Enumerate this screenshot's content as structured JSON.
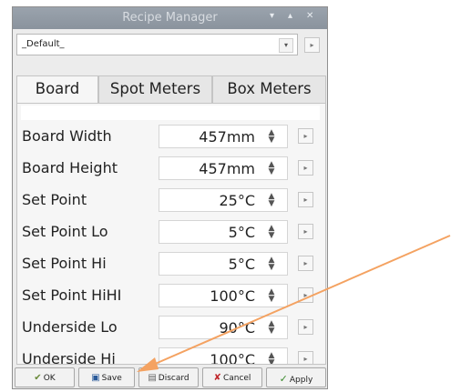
{
  "window": {
    "title": "Recipe Manager",
    "controls": [
      "▾",
      "▴",
      "✕"
    ]
  },
  "recipe_select": {
    "value": "_Default_",
    "arrow_glyph": "▾",
    "side_glyph": "▸"
  },
  "tabs": [
    {
      "label": "Board",
      "active": true
    },
    {
      "label": "Spot Meters",
      "active": false
    },
    {
      "label": "Box Meters",
      "active": false
    }
  ],
  "rows": [
    {
      "label": "Board Width",
      "value": "457mm"
    },
    {
      "label": "Board Height",
      "value": "457mm"
    },
    {
      "label": "Set Point",
      "value": "25°C"
    },
    {
      "label": "Set Point Lo",
      "value": "5°C"
    },
    {
      "label": "Set Point Hi",
      "value": "5°C"
    },
    {
      "label": "Set Point HiHI",
      "value": "100°C"
    },
    {
      "label": "Underside Lo",
      "value": "90°C"
    },
    {
      "label": "Underside Hi",
      "value": "100°C"
    }
  ],
  "spin_glyph": "▲\n▼",
  "row_button_glyph": "▸",
  "buttons": [
    {
      "label": "OK",
      "icon": "✔"
    },
    {
      "label": "Save",
      "icon": "▣"
    },
    {
      "label": "Discard",
      "icon": "▤"
    },
    {
      "label": "Cancel",
      "icon": "✘"
    },
    {
      "label": "Apply",
      "icon": "✓"
    }
  ],
  "colors": {
    "annotation_arrow": "#f4a261",
    "titlebar": "#8f98a3"
  }
}
